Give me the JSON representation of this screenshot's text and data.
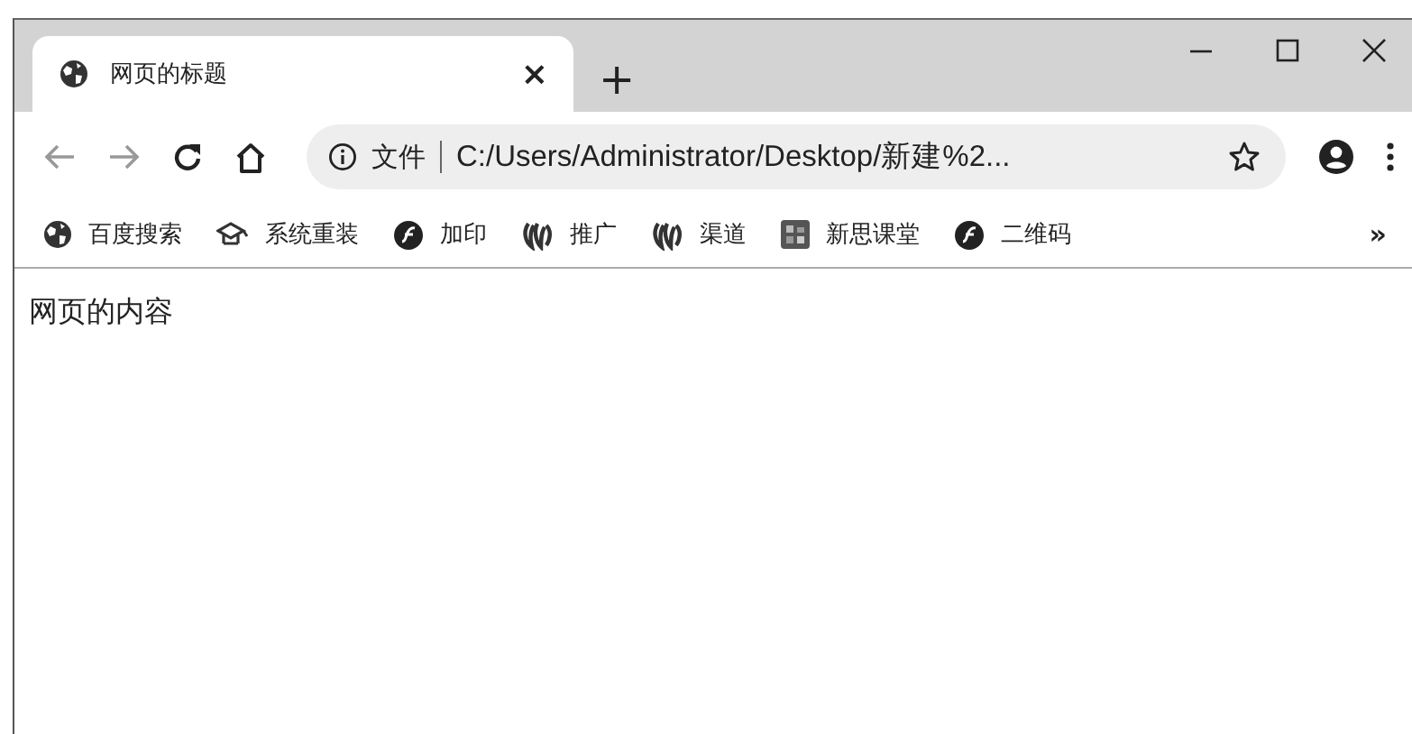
{
  "tab": {
    "title": "网页的标题",
    "close": "×",
    "selected": true
  },
  "new_tab": "+",
  "address": {
    "scheme_label": "文件",
    "url": "C:/Users/Administrator/Desktop/新建%2..."
  },
  "bookmarks": [
    {
      "label": "百度搜索",
      "kind": "globe"
    },
    {
      "label": "系统重装",
      "kind": "cap"
    },
    {
      "label": "加印",
      "kind": "sf"
    },
    {
      "label": "推广",
      "kind": "leaf"
    },
    {
      "label": "渠道",
      "kind": "leaf"
    },
    {
      "label": "新思课堂",
      "kind": "tile"
    },
    {
      "label": "二维码",
      "kind": "sf"
    }
  ],
  "bookmarks_more": "»",
  "page": {
    "text": "网页的内容"
  }
}
